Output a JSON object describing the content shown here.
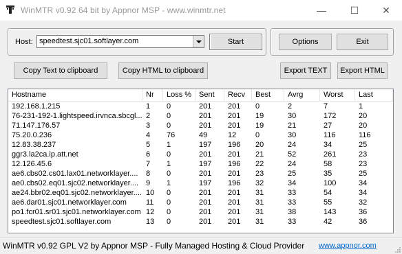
{
  "window": {
    "title": "WinMTR v0.92 64 bit by Appnor MSP - www.winmtr.net",
    "minimize": "—",
    "maximize": "☐",
    "close": "✕"
  },
  "host": {
    "label": "Host:",
    "value": "speedtest.sjc01.softlayer.com",
    "start_button": "Start"
  },
  "options": {
    "options_button": "Options",
    "exit_button": "Exit"
  },
  "export": {
    "copy_text": "Copy Text to clipboard",
    "copy_html": "Copy HTML to clipboard",
    "export_text": "Export TEXT",
    "export_html": "Export HTML"
  },
  "table": {
    "columns": [
      "Hostname",
      "Nr",
      "Loss %",
      "Sent",
      "Recv",
      "Best",
      "Avrg",
      "Worst",
      "Last"
    ],
    "rows": [
      [
        "192.168.1.215",
        "1",
        "0",
        "201",
        "201",
        "0",
        "2",
        "7",
        "1"
      ],
      [
        "76-231-192-1.lightspeed.irvnca.sbcgl...",
        "2",
        "0",
        "201",
        "201",
        "19",
        "30",
        "172",
        "20"
      ],
      [
        "71.147.176.57",
        "3",
        "0",
        "201",
        "201",
        "19",
        "21",
        "27",
        "20"
      ],
      [
        "75.20.0.236",
        "4",
        "76",
        "49",
        "12",
        "0",
        "30",
        "116",
        "116"
      ],
      [
        "12.83.38.237",
        "5",
        "1",
        "197",
        "196",
        "20",
        "24",
        "34",
        "25"
      ],
      [
        "ggr3.la2ca.ip.att.net",
        "6",
        "0",
        "201",
        "201",
        "21",
        "52",
        "261",
        "23"
      ],
      [
        "12.126.45.6",
        "7",
        "1",
        "197",
        "196",
        "22",
        "24",
        "58",
        "23"
      ],
      [
        "ae6.cbs02.cs01.lax01.networklayer....",
        "8",
        "0",
        "201",
        "201",
        "23",
        "25",
        "35",
        "25"
      ],
      [
        "ae0.cbs02.eq01.sjc02.networklayer....",
        "9",
        "1",
        "197",
        "196",
        "32",
        "34",
        "100",
        "34"
      ],
      [
        "ae24.bbr02.eq01.sjc02.networklayer....",
        "10",
        "0",
        "201",
        "201",
        "31",
        "33",
        "54",
        "34"
      ],
      [
        "ae6.dar01.sjc01.networklayer.com",
        "11",
        "0",
        "201",
        "201",
        "31",
        "33",
        "55",
        "32"
      ],
      [
        "po1.fcr01.sr01.sjc01.networklayer.com",
        "12",
        "0",
        "201",
        "201",
        "31",
        "38",
        "143",
        "36"
      ],
      [
        "speedtest.sjc01.softlayer.com",
        "13",
        "0",
        "201",
        "201",
        "31",
        "33",
        "42",
        "36"
      ]
    ]
  },
  "status": {
    "text": "WinMTR v0.92 GPL V2 by Appnor MSP - Fully Managed Hosting & Cloud Provider",
    "link": "www.appnor.com"
  }
}
